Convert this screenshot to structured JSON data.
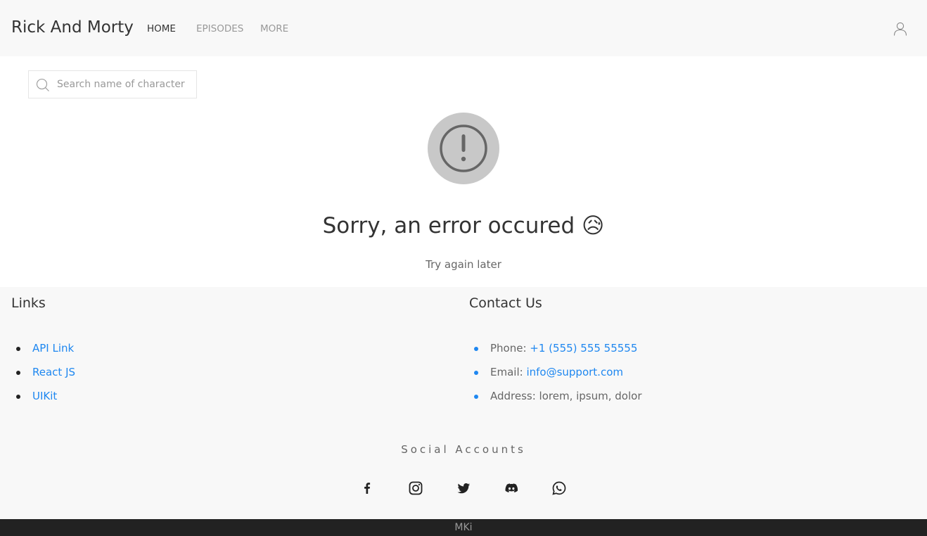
{
  "navbar": {
    "brand": "Rick And Morty",
    "items": [
      {
        "label": "HOME",
        "active": true
      },
      {
        "label": "EPISODES",
        "active": false
      },
      {
        "label": "MORE",
        "active": false
      }
    ],
    "user_icon": "user-icon"
  },
  "search": {
    "placeholder": "Search name of character",
    "icon": "search-icon"
  },
  "error": {
    "icon": "exclamation-circle-icon",
    "title": "Sorry, an error occured 😥",
    "subtitle": "Try again later"
  },
  "footer": {
    "links": {
      "title": "Links",
      "items": [
        "API Link",
        "React JS",
        "UIKit"
      ]
    },
    "contact": {
      "title": "Contact Us",
      "phone_label": "Phone: ",
      "phone_value": "+1 (555) 555 55555",
      "email_label": "Email: ",
      "email_value": "info@support.com",
      "address": "Address: lorem, ipsum, dolor"
    },
    "social": {
      "title": "Social Accounts",
      "icons": [
        "facebook-icon",
        "instagram-icon",
        "twitter-icon",
        "discord-icon",
        "whatsapp-icon"
      ]
    }
  },
  "bottom_bar": {
    "text": "MKi"
  },
  "colors": {
    "link": "#1e87f0",
    "navbar_bg": "#f8f8f8",
    "footer_dark": "#222222"
  }
}
